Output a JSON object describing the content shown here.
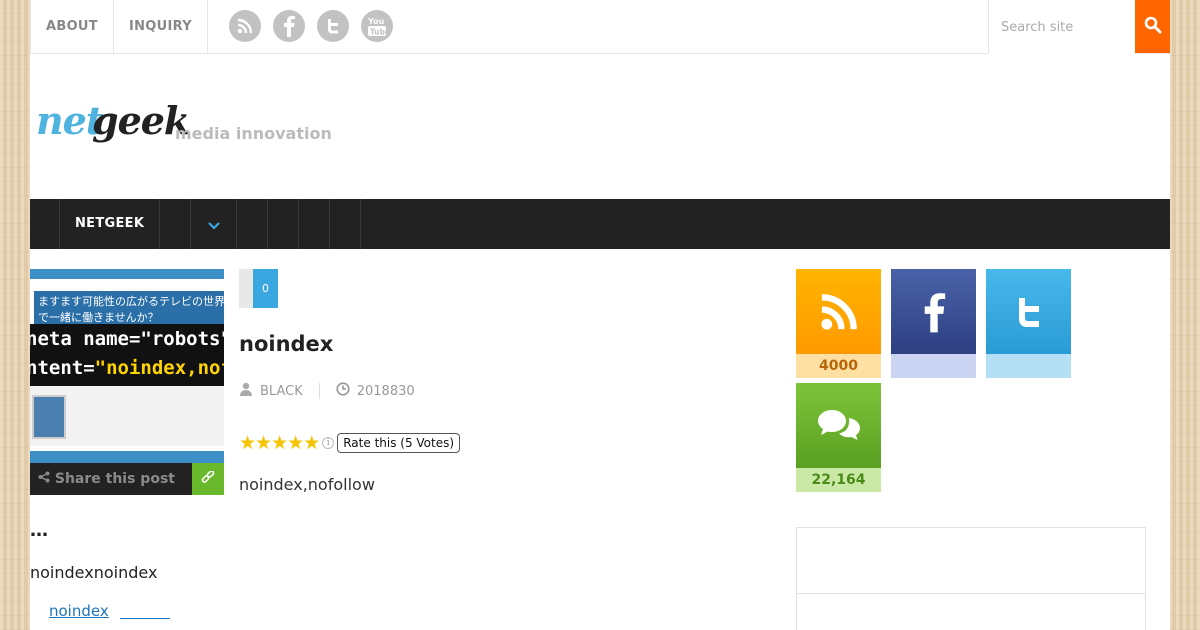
{
  "topbar": {
    "nav": [
      "ABOUT",
      "INQUIRY"
    ],
    "social_icons": [
      "rss-icon",
      "facebook-icon",
      "twitter-icon",
      "youtube-icon"
    ],
    "search_placeholder": "Search site"
  },
  "brand": {
    "logo_part1": "net",
    "logo_part2": "geek",
    "tagline": "media innovation"
  },
  "mainnav": {
    "item": "NETGEEK"
  },
  "thumbnail": {
    "line_jp": "ますます可能性の広がるテレビの世界で一緒に働きませんか？",
    "code_line1_pre": "neta name=",
    "code_line1_val": "\"robots\"",
    "code_line2_pre": "ntent=",
    "code_line2_val": "\"noindex,nof"
  },
  "share": {
    "label": "Share this post"
  },
  "left": {
    "ellipsis": "…",
    "description": "noindexnoindex",
    "tag_link": "noindex"
  },
  "post": {
    "comment_count": "0",
    "title": "noindex",
    "author": "BLACK",
    "date": "2018830",
    "rating": 5,
    "rating_tip": "Rate this (5 Votes)",
    "body": "noindex,nofollow"
  },
  "sidebar": {
    "rss": {
      "count": "4000",
      "color": "#ffa500"
    },
    "facebook": {
      "count": "",
      "color": "#3b5998"
    },
    "twitter": {
      "count": "",
      "color": "#3aaee0"
    },
    "comments": {
      "count": "22,164",
      "color": "#6ab82c"
    }
  },
  "colors": {
    "accent_orange": "#ff6600",
    "nav_dark": "#222222",
    "link_blue": "#1e73be"
  }
}
